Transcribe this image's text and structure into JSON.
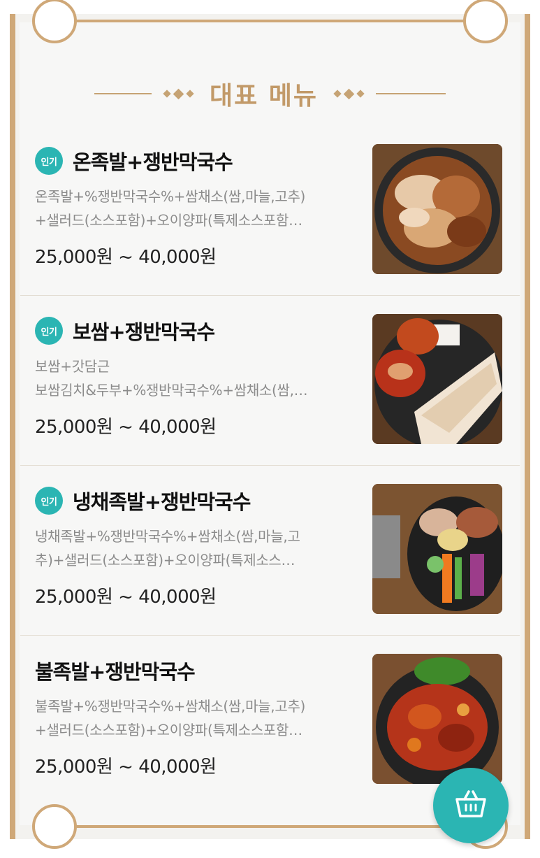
{
  "section": {
    "title": "대표 메뉴"
  },
  "menu": {
    "items": [
      {
        "badge": "인기",
        "name": "온족발+쟁반막국수",
        "desc_line1": "온족발+%쟁반막국수%+쌈채소(쌈,마늘,고추)",
        "desc_line2": "+샐러드(소스포함)+오이양파(특제소스포함…",
        "price": "25,000원 ~ 40,000원"
      },
      {
        "badge": "인기",
        "name": "보쌈+쟁반막국수",
        "desc_line1": "보쌈+갓담근",
        "desc_line2": "보쌈김치&두부+%쟁반막국수%+쌈채소(쌈,…",
        "price": "25,000원 ~ 40,000원"
      },
      {
        "badge": "인기",
        "name": "냉채족발+쟁반막국수",
        "desc_line1": "냉채족발+%쟁반막국수%+쌈채소(쌈,마늘,고",
        "desc_line2": "추)+샐러드(소스포함)+오이양파(특제소스…",
        "price": "25,000원 ~ 40,000원"
      },
      {
        "name": "불족발+쟁반막국수",
        "desc_line1": "불족발+%쟁반막국수%+쌈채소(쌈,마늘,고추)",
        "desc_line2": "+샐러드(소스포함)+오이양파(특제소스포함…",
        "price": "25,000원 ~ 40,000원"
      }
    ]
  },
  "icons": {
    "cart": "shopping-basket-icon",
    "ornament": "diamond-ornament-icon"
  },
  "colors": {
    "accent": "#2bb5b3",
    "gold": "#c29a69",
    "frame": "#cfa878",
    "price": "#222222",
    "desc": "#8b8b8b"
  }
}
